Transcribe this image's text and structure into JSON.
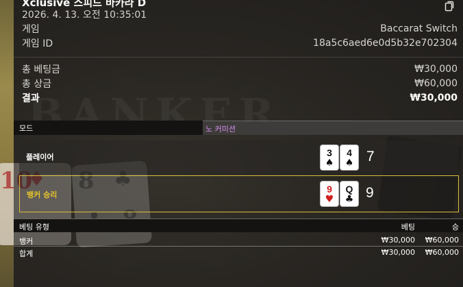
{
  "header": {
    "title": "Xclusive 스피드 바카라 D",
    "datetime": "2026. 4. 13. 오전 10:35:01",
    "game_label": "게임",
    "game_value": "Baccarat Switch",
    "game_id_label": "게임 ID",
    "game_id_value": "18a5c6aed6e0d5b32e702304"
  },
  "summary": {
    "total_bet_label": "총 베팅금",
    "total_bet_value": "₩30,000",
    "total_win_label": "총 상금",
    "total_win_value": "₩60,000",
    "result_label": "결과",
    "result_value": "₩30,000"
  },
  "mode": {
    "label": "모드",
    "value": "노 커미션",
    "value_color": "#d78ef0"
  },
  "player": {
    "label": "플레이어",
    "cards": [
      {
        "rank": "3",
        "suit": "♠",
        "color": "black"
      },
      {
        "rank": "4",
        "suit": "♠",
        "color": "black"
      }
    ],
    "score": "7"
  },
  "banker": {
    "label": "뱅커 승리",
    "label_color": "#e6c52c",
    "cards": [
      {
        "rank": "9",
        "suit": "♥",
        "color": "red"
      },
      {
        "rank": "Q",
        "suit": "♣",
        "color": "black"
      }
    ],
    "score": "9"
  },
  "bets": {
    "headers": {
      "type": "베팅 유형",
      "bet": "베팅",
      "win": "승"
    },
    "rows": [
      {
        "type": "뱅커",
        "bet": "₩30,000",
        "win": "₩60,000"
      }
    ],
    "total": {
      "type": "합계",
      "bet": "₩30,000",
      "win": "₩60,000"
    }
  },
  "icons": {
    "copy": "copy-icon"
  }
}
